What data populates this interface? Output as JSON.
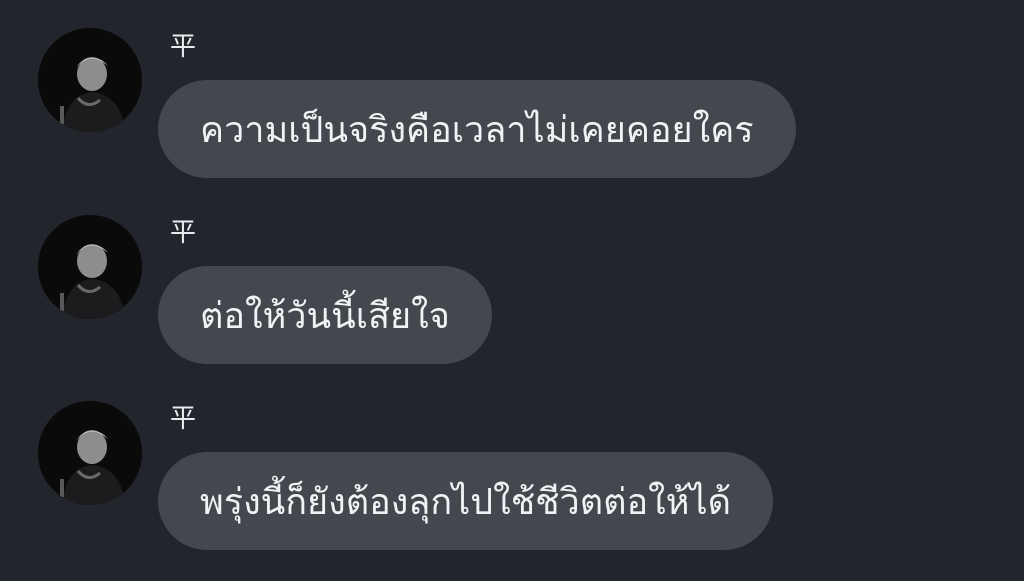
{
  "messages": [
    {
      "sender": "平",
      "text": "ความเป็นจริงคือเวลาไม่เคยคอยใคร",
      "avatar": "user-avatar"
    },
    {
      "sender": "平",
      "text": "ต่อให้วันนี้เสียใจ",
      "avatar": "user-avatar"
    },
    {
      "sender": "平",
      "text": "พรุ่งนี้ก็ยังต้องลุกไปใช้ชีวิตต่อให้ได้",
      "avatar": "user-avatar"
    }
  ],
  "colors": {
    "background": "#23252c",
    "bubble": "#45474f",
    "text": "#f1f2f4",
    "sender": "#e9eaee"
  }
}
